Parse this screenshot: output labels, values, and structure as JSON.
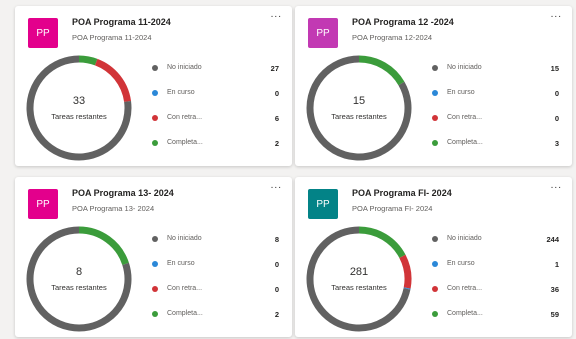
{
  "colors": {
    "not_started": "#616161",
    "in_progress": "#2b88d8",
    "late": "#d13438",
    "completed": "#3b9c3b",
    "avatar_magenta": "#e3008c",
    "avatar_teal": "#038387"
  },
  "cards": [
    {
      "avatar": "PP",
      "avatar_color": "#e3008c",
      "title": "POA Programa 11-2024",
      "subtitle": "POA Programa 11-2024",
      "more": "...",
      "remaining_count": "33",
      "remaining_label": "Tareas restantes",
      "legend": [
        {
          "name": "No iniciado",
          "value": "27",
          "key": "not_started"
        },
        {
          "name": "En curso",
          "value": "0",
          "key": "in_progress"
        },
        {
          "name": "Con retra...",
          "value": "6",
          "key": "late"
        },
        {
          "name": "Completa...",
          "value": "2",
          "key": "completed"
        }
      ]
    },
    {
      "avatar": "PP",
      "avatar_color": "#c239b3",
      "title": "POA Programa 12 -2024",
      "subtitle": "POA Programa 12-2024",
      "more": "...",
      "remaining_count": "15",
      "remaining_label": "Tareas restantes",
      "legend": [
        {
          "name": "No iniciado",
          "value": "15",
          "key": "not_started"
        },
        {
          "name": "En curso",
          "value": "0",
          "key": "in_progress"
        },
        {
          "name": "Con retra...",
          "value": "0",
          "key": "late"
        },
        {
          "name": "Completa...",
          "value": "3",
          "key": "completed"
        }
      ]
    },
    {
      "avatar": "PP",
      "avatar_color": "#e3008c",
      "title": "POA Programa 13- 2024",
      "subtitle": "POA Programa 13- 2024",
      "more": "...",
      "remaining_count": "8",
      "remaining_label": "Tareas restantes",
      "legend": [
        {
          "name": "No iniciado",
          "value": "8",
          "key": "not_started"
        },
        {
          "name": "En curso",
          "value": "0",
          "key": "in_progress"
        },
        {
          "name": "Con retra...",
          "value": "0",
          "key": "late"
        },
        {
          "name": "Completa...",
          "value": "2",
          "key": "completed"
        }
      ]
    },
    {
      "avatar": "PP",
      "avatar_color": "#038387",
      "title": "POA Programa FI- 2024",
      "subtitle": "POA Programa FI- 2024",
      "more": "...",
      "remaining_count": "281",
      "remaining_label": "Tareas restantes",
      "legend": [
        {
          "name": "No iniciado",
          "value": "244",
          "key": "not_started"
        },
        {
          "name": "En curso",
          "value": "1",
          "key": "in_progress"
        },
        {
          "name": "Con retra...",
          "value": "36",
          "key": "late"
        },
        {
          "name": "Completa...",
          "value": "59",
          "key": "completed"
        }
      ]
    }
  ]
}
